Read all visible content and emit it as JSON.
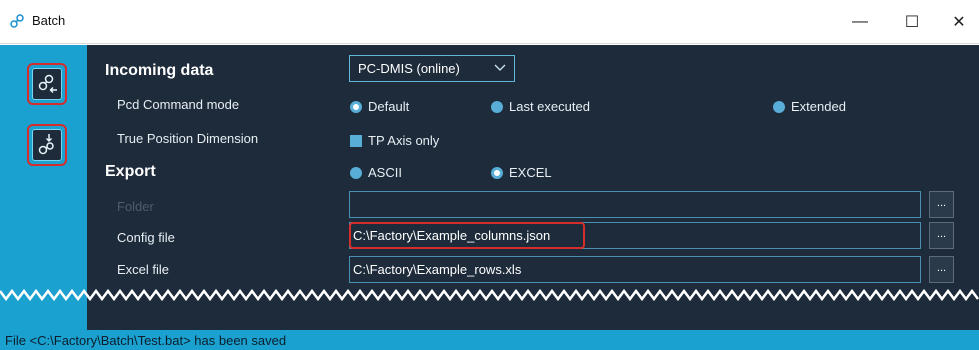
{
  "window": {
    "title": "Batch",
    "minimize_glyph": "—",
    "maximize_glyph": "☐",
    "close_glyph": "✕"
  },
  "sidebar": {
    "buttons": [
      {
        "icon": "load-config-icon"
      },
      {
        "icon": "import-config-icon"
      }
    ]
  },
  "incoming": {
    "heading": "Incoming data",
    "source_value": "PC-DMIS (online)",
    "pcd_label": "Pcd Command mode",
    "pcd_options": [
      {
        "label": "Default",
        "selected": true
      },
      {
        "label": "Last executed",
        "selected": false
      },
      {
        "label": "Extended",
        "selected": false
      }
    ],
    "tp_label": "True Position Dimension",
    "tp_checkbox_label": "TP Axis only"
  },
  "export": {
    "heading": "Export",
    "options": [
      {
        "label": "ASCII",
        "selected": false
      },
      {
        "label": "EXCEL",
        "selected": true
      }
    ],
    "folder_label": "Folder",
    "folder_value": "",
    "config_label": "Config file",
    "config_value": "C:\\Factory\\Example_columns.json",
    "excel_label": "Excel file",
    "excel_value": "C:\\Factory\\Example_rows.xls",
    "browse_label": "..."
  },
  "status": {
    "message": "File <C:\\Factory\\Batch\\Test.bat> has been saved"
  },
  "colors": {
    "accent": "#1aa1cf",
    "panel": "#1d2b3b",
    "highlight": "#d62c2c"
  }
}
